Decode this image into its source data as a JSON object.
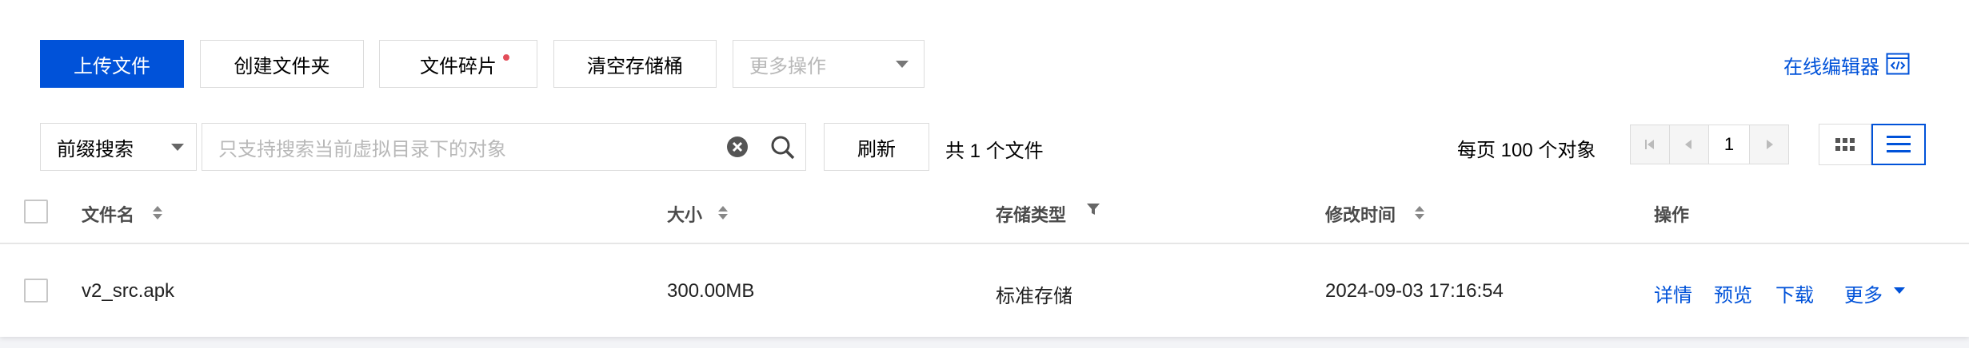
{
  "toolbar": {
    "upload_label": "上传文件",
    "create_folder_label": "创建文件夹",
    "fragments_label": "文件碎片",
    "clear_bucket_label": "清空存储桶",
    "more_actions_placeholder": "更多操作",
    "online_editor_label": "在线编辑器"
  },
  "search": {
    "mode_label": "前缀搜索",
    "placeholder": "只支持搜索当前虚拟目录下的对象",
    "refresh_label": "刷新",
    "total_label": "共 1 个文件"
  },
  "pager": {
    "per_page_label": "每页 100 个对象",
    "current_page": "1"
  },
  "table": {
    "headers": {
      "name": "文件名",
      "size": "大小",
      "storage_type": "存储类型",
      "modified": "修改时间",
      "actions": "操作"
    },
    "rows": [
      {
        "name": "v2_src.apk",
        "size": "300.00MB",
        "storage_type": "标准存储",
        "modified": "2024-09-03 17:16:54",
        "actions": {
          "details": "详情",
          "preview": "预览",
          "download": "下载",
          "more": "更多"
        }
      }
    ]
  },
  "colors": {
    "primary": "#0052d9",
    "dot": "#e34d59",
    "border": "#dcdcdc"
  },
  "icons": [
    "clear-icon",
    "search-icon",
    "filter-icon",
    "editor-code-icon",
    "first-page-icon",
    "prev-page-icon",
    "next-page-icon",
    "grid-view-icon",
    "list-view-icon",
    "caret-down-icon",
    "sort-icon"
  ]
}
